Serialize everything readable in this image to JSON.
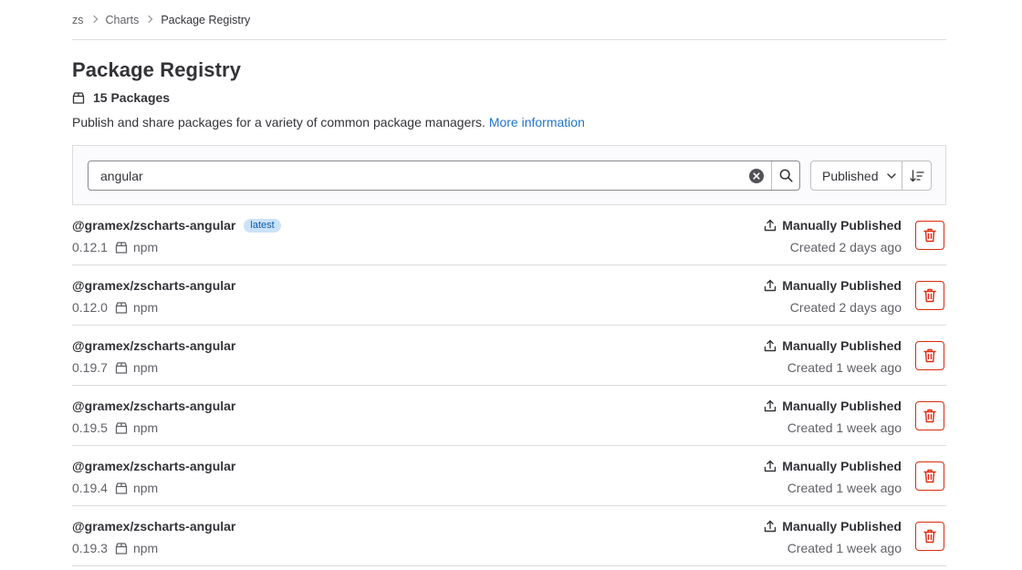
{
  "breadcrumb": [
    "zs",
    "Charts",
    "Package Registry"
  ],
  "page_title": "Package Registry",
  "package_count": "15 Packages",
  "description": {
    "text": "Publish and share packages for a variety of common package managers. ",
    "link": "More information"
  },
  "search": {
    "value": "angular"
  },
  "sort": {
    "selected": "Published"
  },
  "packages": [
    {
      "name": "@gramex/zscharts-angular",
      "badge": "latest",
      "version": "0.12.1",
      "type": "npm",
      "status": "Manually Published",
      "created": "Created 2 days ago"
    },
    {
      "name": "@gramex/zscharts-angular",
      "badge": "",
      "version": "0.12.0",
      "type": "npm",
      "status": "Manually Published",
      "created": "Created 2 days ago"
    },
    {
      "name": "@gramex/zscharts-angular",
      "badge": "",
      "version": "0.19.7",
      "type": "npm",
      "status": "Manually Published",
      "created": "Created 1 week ago"
    },
    {
      "name": "@gramex/zscharts-angular",
      "badge": "",
      "version": "0.19.5",
      "type": "npm",
      "status": "Manually Published",
      "created": "Created 1 week ago"
    },
    {
      "name": "@gramex/zscharts-angular",
      "badge": "",
      "version": "0.19.4",
      "type": "npm",
      "status": "Manually Published",
      "created": "Created 1 week ago"
    },
    {
      "name": "@gramex/zscharts-angular",
      "badge": "",
      "version": "0.19.3",
      "type": "npm",
      "status": "Manually Published",
      "created": "Created 1 week ago"
    }
  ],
  "colors": {
    "link": "#1f75cb",
    "danger": "#dd2b0e",
    "badge_bg": "#cbe2f9",
    "badge_text": "#0b5cad"
  }
}
